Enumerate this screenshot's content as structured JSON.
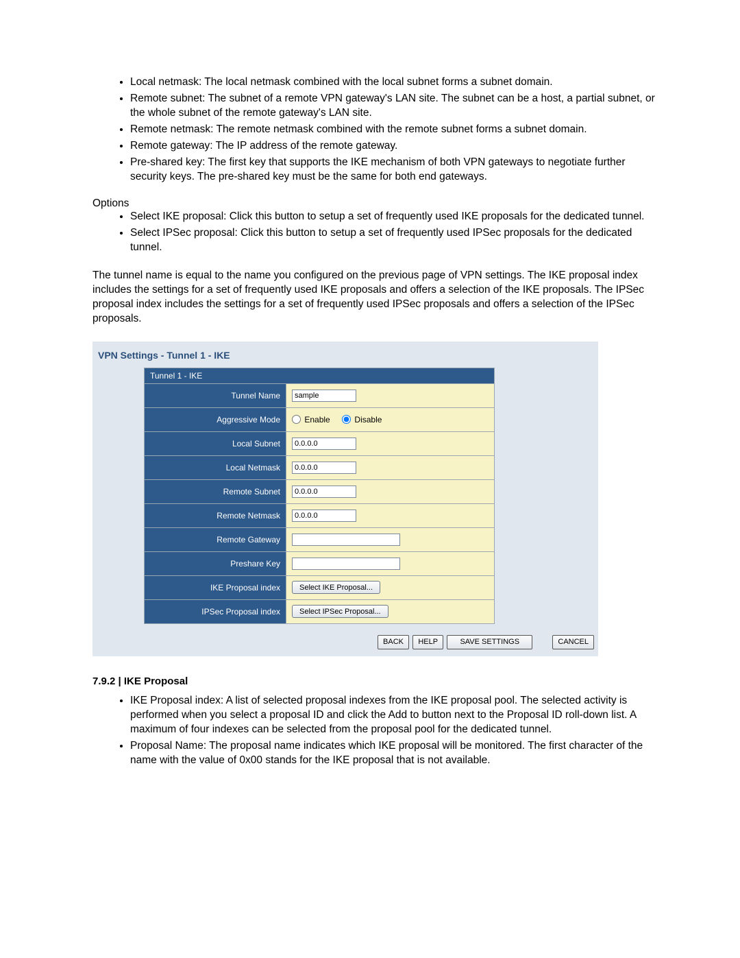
{
  "intro_bullets": [
    "Local netmask: The local netmask combined with the local subnet forms a subnet domain.",
    "Remote subnet: The subnet of a remote VPN gateway's LAN site. The subnet can be a host, a partial subnet, or the whole subnet of the remote gateway's LAN site.",
    "Remote netmask: The remote netmask combined with the remote subnet forms a subnet domain.",
    "Remote gateway: The IP address of the remote gateway.",
    "Pre-shared key: The first key that supports the IKE mechanism of both VPN gateways to negotiate further security keys. The pre-shared key must be the same for both end gateways."
  ],
  "options_heading": "Options",
  "options_bullets": [
    "Select IKE proposal: Click this button to setup a set of frequently used IKE proposals for the dedicated tunnel.",
    "Select IPSec proposal: Click this button to setup a set of frequently used IPSec proposals for the dedicated tunnel."
  ],
  "paragraph": "The tunnel name is equal to the name you configured on the previous page of VPN settings. The IKE proposal index includes the settings for a set of frequently used IKE proposals and offers a selection of the IKE proposals. The IPSec proposal index includes the settings for a set of frequently used IPSec proposals and offers a selection of the IPSec proposals.",
  "panel": {
    "title": "VPN Settings - Tunnel 1 - IKE",
    "table_header": "Tunnel 1 - IKE",
    "rows": {
      "tunnel_name_label": "Tunnel Name",
      "tunnel_name_value": "sample",
      "aggr_label": "Aggressive Mode",
      "aggr_enable": "Enable",
      "aggr_disable": "Disable",
      "local_subnet_label": "Local Subnet",
      "local_subnet_value": "0.0.0.0",
      "local_netmask_label": "Local Netmask",
      "local_netmask_value": "0.0.0.0",
      "remote_subnet_label": "Remote Subnet",
      "remote_subnet_value": "0.0.0.0",
      "remote_netmask_label": "Remote Netmask",
      "remote_netmask_value": "0.0.0.0",
      "remote_gateway_label": "Remote Gateway",
      "remote_gateway_value": "",
      "preshare_label": "Preshare Key",
      "preshare_value": "",
      "ike_idx_label": "IKE Proposal index",
      "ike_idx_btn": "Select IKE Proposal...",
      "ipsec_idx_label": "IPSec Proposal index",
      "ipsec_idx_btn": "Select IPSec Proposal..."
    },
    "buttons": {
      "back": "BACK",
      "help": "HELP",
      "save": "SAVE SETTINGS",
      "cancel": "CANCEL"
    }
  },
  "section_heading": "7.9.2 | IKE Proposal",
  "section_bullets": [
    "IKE Proposal index: A list of selected proposal indexes from the IKE proposal pool. The selected activity is performed when you select a proposal ID and click the Add to button next to the Proposal ID roll-down list. A maximum of four indexes can be selected from the proposal pool for the dedicated tunnel.",
    "Proposal Name: The proposal name indicates which IKE proposal will be monitored. The first character of the name with the value of 0x00 stands for the IKE proposal that is not available."
  ]
}
